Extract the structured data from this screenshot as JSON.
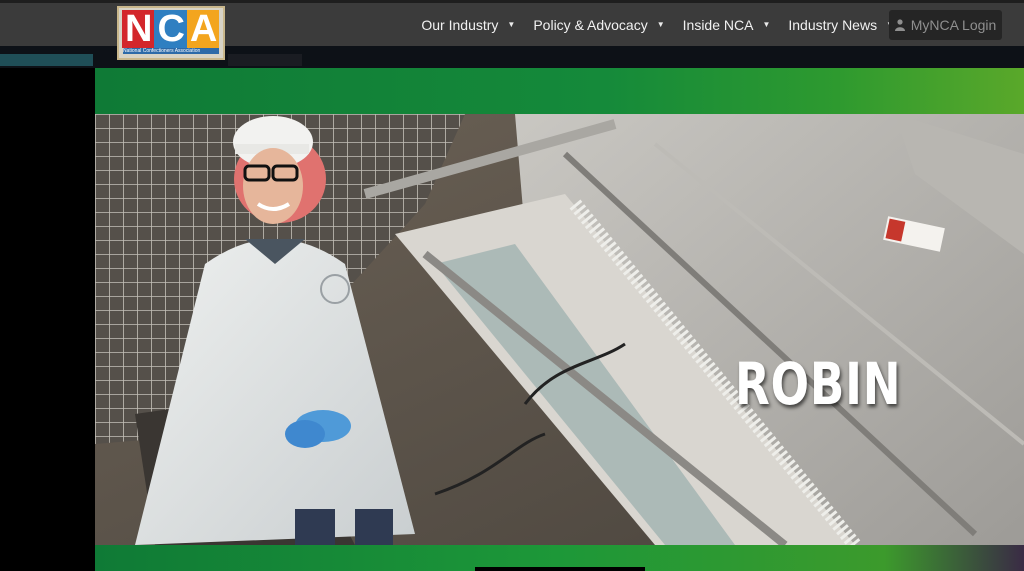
{
  "logo": {
    "letters": [
      "N",
      "C",
      "A"
    ],
    "tagline": "National Confectioners Association"
  },
  "nav": {
    "items": [
      {
        "label": "Our Industry"
      },
      {
        "label": "Policy & Advocacy"
      },
      {
        "label": "Inside NCA"
      },
      {
        "label": "Industry News"
      }
    ],
    "login_label": "MyNCA Login"
  },
  "video": {
    "overlay_name": "ROBIN"
  },
  "colors": {
    "nav_bg": "#3b3b3b",
    "band_green": "#158a3a",
    "logo_red": "#d3262b",
    "logo_blue": "#2f7fc1",
    "logo_yellow": "#f3a51e"
  },
  "icons": {
    "caret": "chevron-down-icon",
    "user": "user-icon"
  }
}
